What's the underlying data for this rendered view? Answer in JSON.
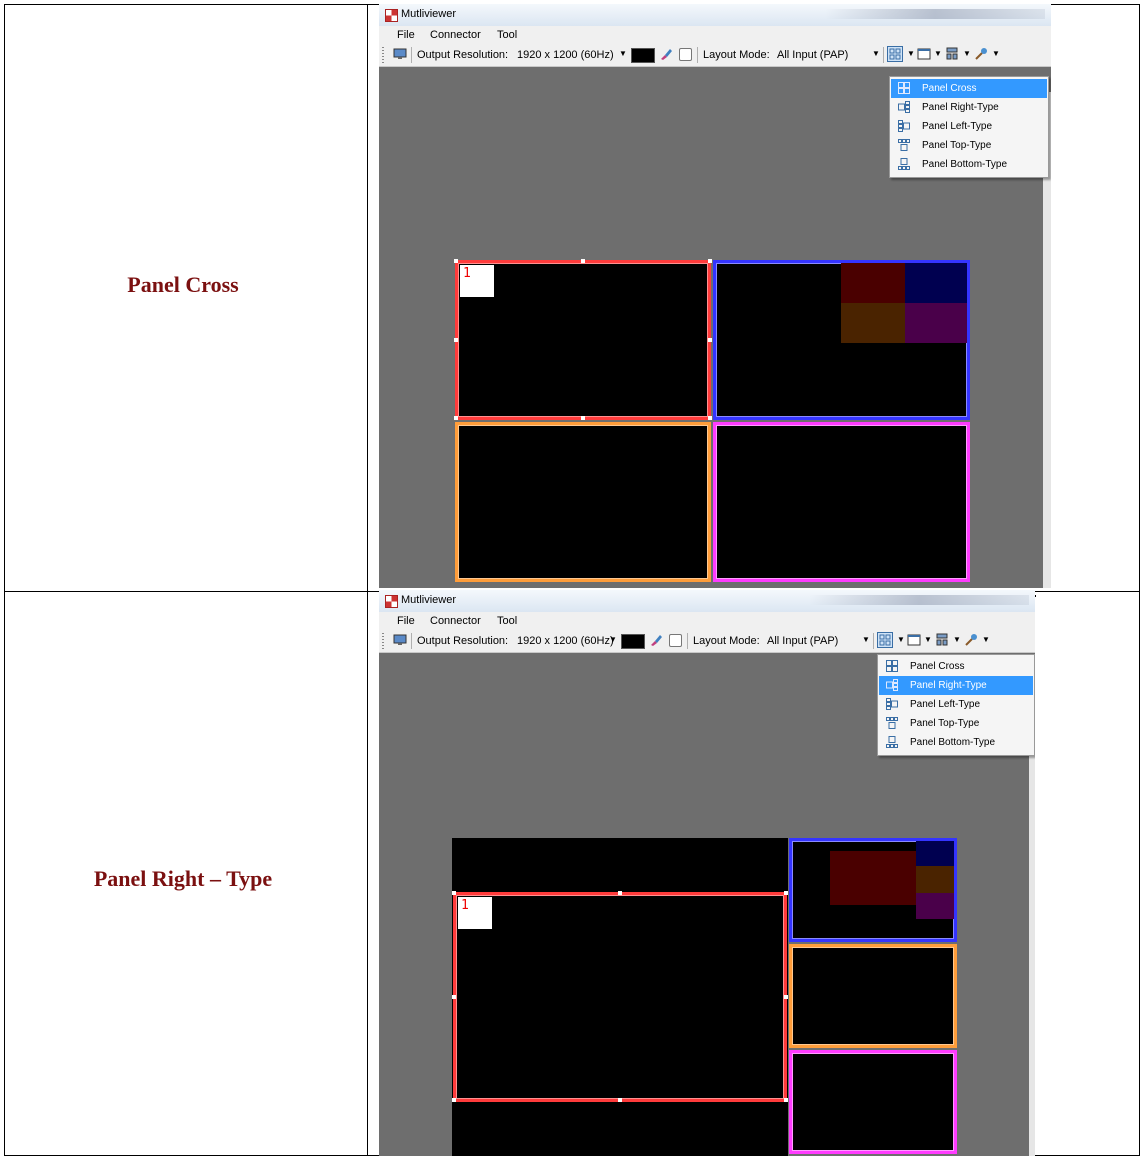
{
  "rows": [
    {
      "label": "Panel Cross",
      "window_title": "Mutliviewer",
      "menu": [
        "File",
        "Connector",
        "Tool"
      ],
      "toolbar": {
        "resolution_label": "Output Resolution:",
        "resolution_value": "1920 x 1200 (60Hz)",
        "layout_label": "Layout Mode:",
        "layout_value": "All Input (PAP)"
      },
      "dropdown": {
        "items": [
          "Panel Cross",
          "Panel Right-Type",
          "Panel Left-Type",
          "Panel Top-Type",
          "Panel Bottom-Type"
        ],
        "selected": 0
      },
      "panel_number": "1"
    },
    {
      "label": "Panel Right – Type",
      "window_title": "Mutliviewer",
      "menu": [
        "File",
        "Connector",
        "Tool"
      ],
      "toolbar": {
        "resolution_label": "Output Resolution:",
        "resolution_value": "1920 x 1200 (60Hz)",
        "layout_label": "Layout Mode:",
        "layout_value": "All Input (PAP)"
      },
      "dropdown": {
        "items": [
          "Panel Cross",
          "Panel Right-Type",
          "Panel Left-Type",
          "Panel Top-Type",
          "Panel Bottom-Type"
        ],
        "selected": 1
      },
      "panel_number": "1"
    }
  ],
  "colors": {
    "label": "#7b1010",
    "panel_red": "#ff3b3b",
    "panel_blue": "#3434ff",
    "panel_orange": "#ff9d3a",
    "panel_magenta": "#ff3bff",
    "menu_highlight": "#3399ff"
  }
}
